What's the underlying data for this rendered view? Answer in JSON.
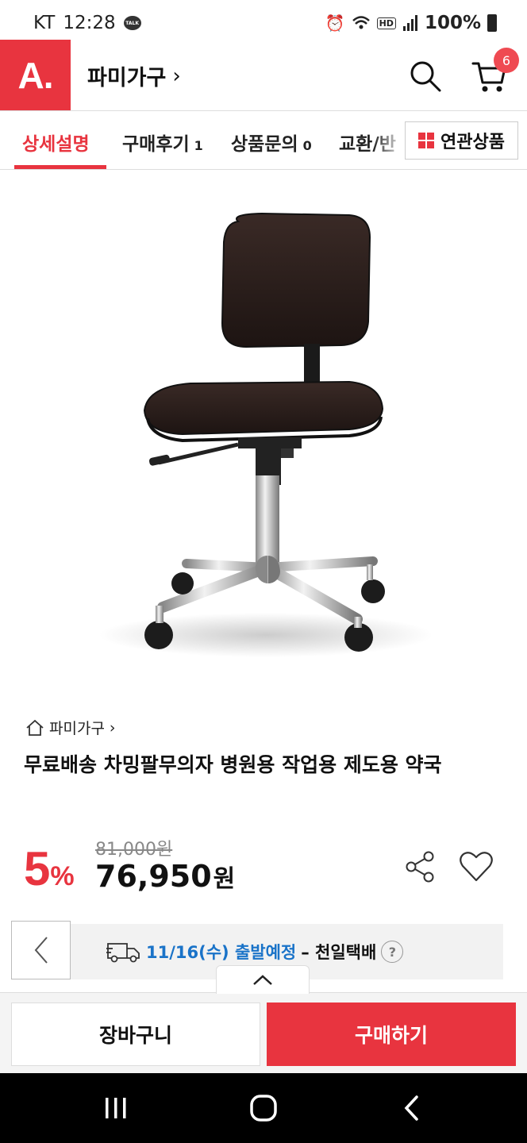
{
  "status_bar": {
    "carrier": "KT",
    "time": "12:28",
    "talk_badge": "TALK",
    "hd": "HD",
    "battery": "100%"
  },
  "header": {
    "logo": "A.",
    "store_name": "파미가구",
    "store_chevron": "›",
    "cart_count": "6"
  },
  "tabs": {
    "items": [
      {
        "label": "상세설명",
        "count": ""
      },
      {
        "label": "구매후기",
        "count": "1"
      },
      {
        "label": "상품문의",
        "count": "0"
      },
      {
        "label": "교환/반",
        "count": ""
      }
    ],
    "related_label": "연관상품"
  },
  "product": {
    "breadcrumb": "파미가구",
    "breadcrumb_chevron": "›",
    "title": "무료배송 차밍팔무의자 병원용 작업용 제도용 약국",
    "discount_num": "5",
    "discount_pct": "%",
    "original_price": "81,000원",
    "price_num": "76,950",
    "price_unit": "원"
  },
  "delivery": {
    "date_text": "11/16(수) 출발예정",
    "carrier_text": "– 천일택배",
    "help": "?"
  },
  "bottom_bar": {
    "cart_label": "장바구니",
    "buy_label": "구매하기"
  },
  "colors": {
    "brand_red": "#e8343f",
    "link_blue": "#1a73c8"
  }
}
